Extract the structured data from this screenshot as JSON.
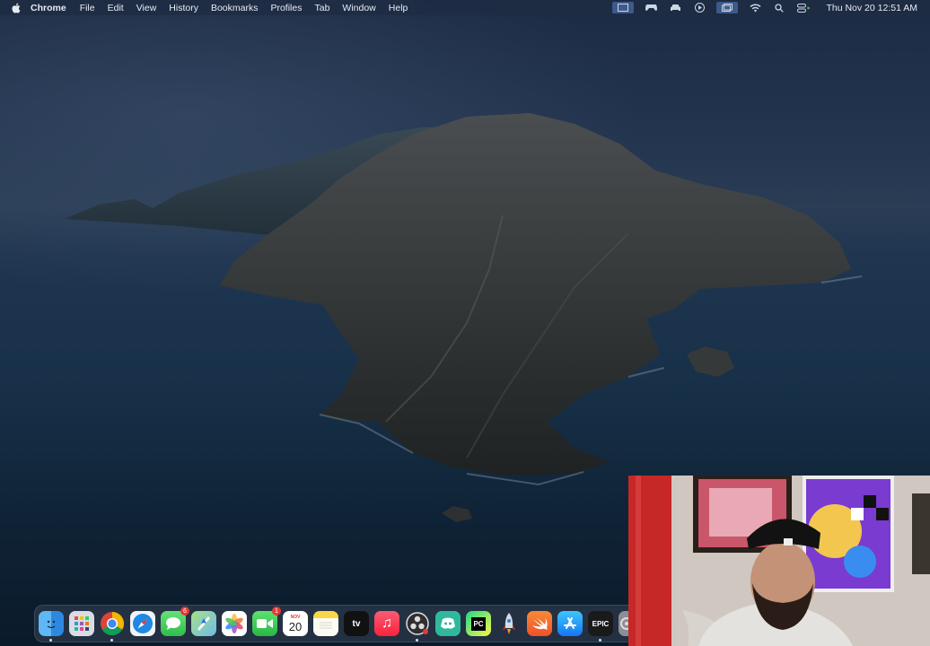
{
  "menubar": {
    "apple": "apple-icon",
    "app_name": "Chrome",
    "menus": [
      "File",
      "Edit",
      "View",
      "History",
      "Bookmarks",
      "Profiles",
      "Tab",
      "Window",
      "Help"
    ],
    "clock": "Thu Nov 20  12:51 AM",
    "status_icons": [
      "screen-share-icon",
      "gamepad-icon",
      "car-icon",
      "play-icon",
      "window-icon",
      "wifi-icon",
      "search-icon",
      "control-center-icon"
    ]
  },
  "dock": {
    "items": [
      {
        "name": "finder-icon",
        "label": ""
      },
      {
        "name": "launchpad-icon",
        "label": ""
      },
      {
        "name": "chrome-icon",
        "label": ""
      },
      {
        "name": "safari-icon",
        "label": ""
      },
      {
        "name": "messages-icon",
        "label": "",
        "badge": "6"
      },
      {
        "name": "maps-icon",
        "label": ""
      },
      {
        "name": "photos-icon",
        "label": ""
      },
      {
        "name": "facetime-icon",
        "label": "",
        "badge": "1"
      },
      {
        "name": "calendar-icon",
        "label": "20",
        "month": "NOV"
      },
      {
        "name": "notes-icon",
        "label": ""
      },
      {
        "name": "apple-tv-icon",
        "label": "tv"
      },
      {
        "name": "music-icon",
        "label": "♫"
      },
      {
        "name": "obs-icon",
        "label": ""
      },
      {
        "name": "discord-icon",
        "label": ""
      },
      {
        "name": "pycharm-icon",
        "label": "PC"
      },
      {
        "name": "rocket-icon",
        "label": ""
      },
      {
        "name": "swift-icon",
        "label": ""
      },
      {
        "name": "app-store-icon",
        "label": ""
      },
      {
        "name": "epic-games-icon",
        "label": "EPIC"
      },
      {
        "name": "system-settings-icon",
        "label": ""
      }
    ]
  },
  "colors": {
    "menubar_bg": "#1e2c42",
    "sea": "#173048",
    "rock": "#3a3c3b",
    "webcam_wall": "#c9c2bc"
  }
}
